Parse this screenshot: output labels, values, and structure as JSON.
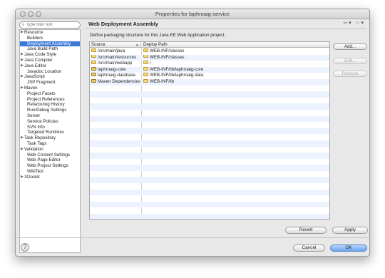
{
  "window": {
    "title": "Properties for laphroaig-service"
  },
  "filter": {
    "placeholder": "type filter text"
  },
  "nav": {
    "items": [
      {
        "label": "Resource",
        "expandable": true,
        "indent": false
      },
      {
        "label": "Builders",
        "expandable": false,
        "indent": true
      },
      {
        "label": "Deployment Assembly",
        "expandable": false,
        "indent": true,
        "selected": true
      },
      {
        "label": "Java Build Path",
        "expandable": false,
        "indent": true
      },
      {
        "label": "Java Code Style",
        "expandable": true,
        "indent": false
      },
      {
        "label": "Java Compiler",
        "expandable": true,
        "indent": false
      },
      {
        "label": "Java Editor",
        "expandable": true,
        "indent": false
      },
      {
        "label": "Javadoc Location",
        "expandable": false,
        "indent": true
      },
      {
        "label": "JavaScript",
        "expandable": true,
        "indent": false
      },
      {
        "label": "JSP Fragment",
        "expandable": false,
        "indent": true
      },
      {
        "label": "Maven",
        "expandable": true,
        "indent": false
      },
      {
        "label": "Project Facets",
        "expandable": false,
        "indent": true
      },
      {
        "label": "Project References",
        "expandable": false,
        "indent": true
      },
      {
        "label": "Refactoring History",
        "expandable": false,
        "indent": true
      },
      {
        "label": "Run/Debug Settings",
        "expandable": false,
        "indent": true
      },
      {
        "label": "Server",
        "expandable": false,
        "indent": true
      },
      {
        "label": "Service Policies",
        "expandable": false,
        "indent": true
      },
      {
        "label": "SVN Info",
        "expandable": false,
        "indent": true
      },
      {
        "label": "Targeted Runtimes",
        "expandable": false,
        "indent": true
      },
      {
        "label": "Task Repository",
        "expandable": true,
        "indent": false
      },
      {
        "label": "Task Tags",
        "expandable": false,
        "indent": true
      },
      {
        "label": "Validation",
        "expandable": true,
        "indent": false
      },
      {
        "label": "Web Content Settings",
        "expandable": false,
        "indent": true
      },
      {
        "label": "Web Page Editor",
        "expandable": false,
        "indent": true
      },
      {
        "label": "Web Project Settings",
        "expandable": false,
        "indent": true
      },
      {
        "label": "WikiText",
        "expandable": false,
        "indent": true
      },
      {
        "label": "XDoclet",
        "expandable": true,
        "indent": false
      }
    ]
  },
  "pane": {
    "title": "Web Deployment Assembly",
    "description": "Define packaging structure for this Java EE Web Application project."
  },
  "table": {
    "columns": {
      "source": "Source",
      "deploy": "Deploy Path"
    },
    "rows": [
      {
        "source": "/src/main/java",
        "deploy": "WEB-INF/classes",
        "source_icon": "folder-icon",
        "deploy_icon": "folder-icon"
      },
      {
        "source": "/src/main/resources",
        "deploy": "WEB-INF/classes",
        "source_icon": "folder-icon",
        "deploy_icon": "folder-icon"
      },
      {
        "source": "/src/main/webapp",
        "deploy": "/",
        "source_icon": "folder-icon",
        "deploy_icon": "folder-icon"
      },
      {
        "source": "laphroaig-core",
        "deploy": "WEB-INF/lib/laphroaig-core",
        "source_icon": "jar-icon",
        "deploy_icon": "folder-icon"
      },
      {
        "source": "laphroaig-database",
        "deploy": "WEB-INF/lib/laphroaig-data",
        "source_icon": "jar-icon",
        "deploy_icon": "folder-icon"
      },
      {
        "source": "Maven Dependencies",
        "deploy": "WEB-INF/lib",
        "source_icon": "jar-icon",
        "deploy_icon": "folder-icon"
      }
    ]
  },
  "side_buttons": {
    "add": "Add...",
    "edit": "Edit...",
    "remove": "Remove"
  },
  "buttons": {
    "revert": "Revert",
    "apply": "Apply",
    "cancel": "Cancel",
    "ok": "OK"
  },
  "help_icon": "?",
  "colors": {
    "selection": "#3b78d8",
    "alt_row": "#edf3fe",
    "ok_button": "#6aa4ef"
  }
}
